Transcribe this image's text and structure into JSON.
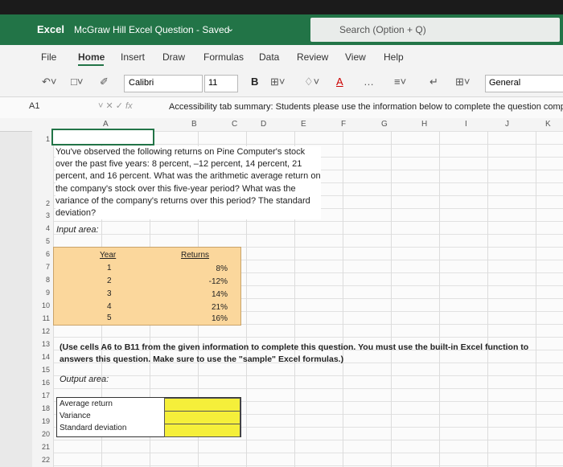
{
  "app": {
    "name": "Excel",
    "doc_title": "McGraw Hill Excel Question - Saved",
    "search_placeholder": "Search (Option + Q)"
  },
  "ribbon_tabs": [
    "File",
    "Home",
    "Insert",
    "Draw",
    "Formulas",
    "Data",
    "Review",
    "View",
    "Help"
  ],
  "toolbar": {
    "font": "Calibri",
    "size": "11",
    "bold": "B",
    "number_format": "General"
  },
  "formula_bar": {
    "cell_ref": "A1",
    "content": "Accessibility tab summary: Students please use the information below to complete the question comp"
  },
  "columns": [
    "A",
    "B",
    "C",
    "D",
    "E",
    "F",
    "G",
    "H",
    "I",
    "J",
    "K"
  ],
  "rows": [
    "1",
    "2",
    "3",
    "4",
    "5",
    "6",
    "7",
    "8",
    "9",
    "10",
    "11",
    "12",
    "13",
    "14",
    "15",
    "16",
    "17",
    "18",
    "19",
    "20",
    "21",
    "22"
  ],
  "question": "You've observed the following returns on Pine Computer's stock over the past five years: 8 percent, –12 percent, 14 percent, 21 percent, and 16 percent. What was the arithmetic average return on the company's stock over this five-year period? What was the variance of the company's returns over this period? The standard deviation?",
  "input_area_label": "Input area:",
  "input_table": {
    "year_header": "Year",
    "returns_header": "Returns",
    "years": [
      "1",
      "2",
      "3",
      "4",
      "5"
    ],
    "returns": [
      "8%",
      "-12%",
      "14%",
      "21%",
      "16%"
    ]
  },
  "note": "(Use cells A6 to B11 from the given information to complete this question. You must use the built-in Excel function to answers this question. Make sure to use the \"sample\" Excel formulas.)",
  "output_area_label": "Output area:",
  "output_rows": [
    "Average return",
    "Variance",
    "Standard deviation"
  ]
}
